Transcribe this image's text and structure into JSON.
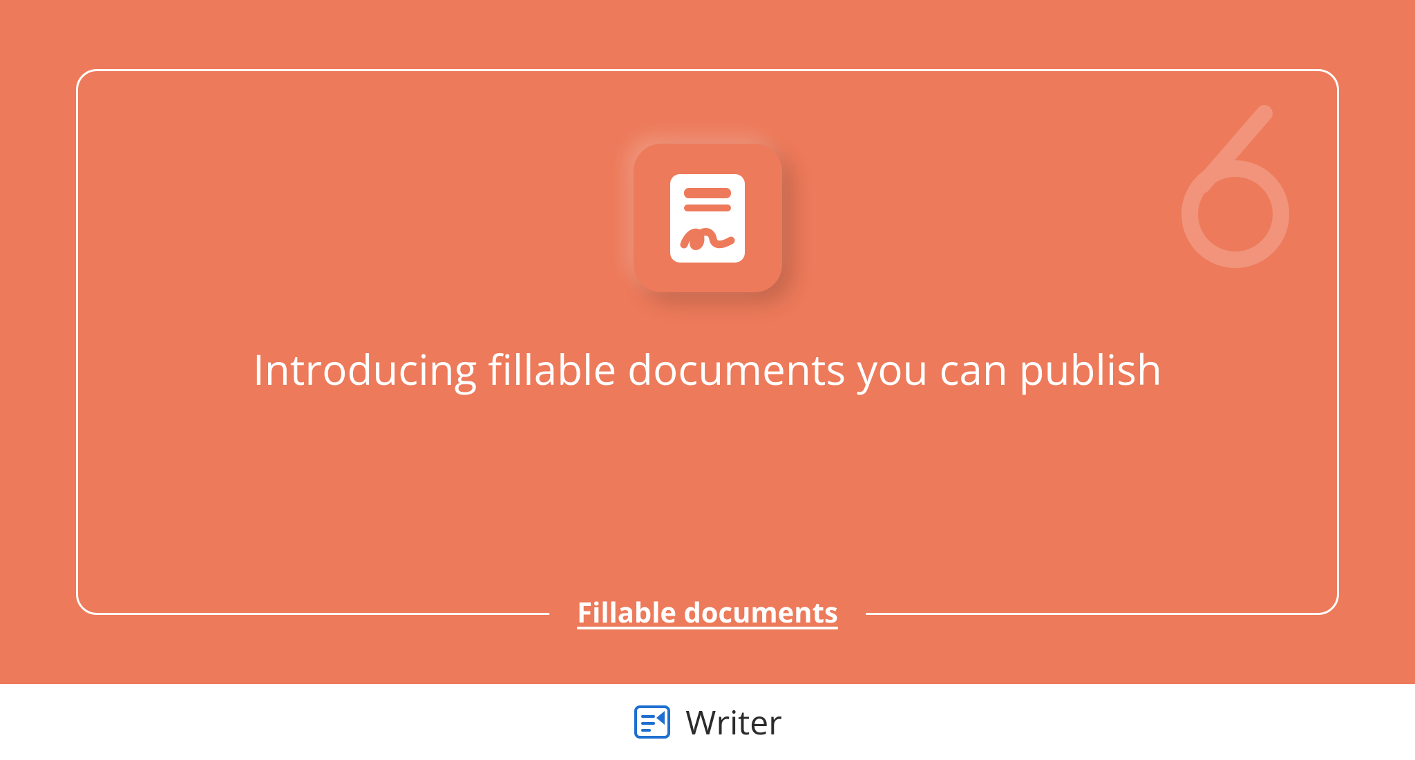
{
  "hero": {
    "headline": "Introducing fillable documents you can publish",
    "subtitle": "Fillable documents",
    "decorative_numeral": "6",
    "icon_name": "fillable-document-icon"
  },
  "footer": {
    "product_name": "Writer",
    "icon_name": "writer-logo-icon"
  },
  "colors": {
    "hero_bg": "#ed7a5a",
    "text_white": "#ffffff",
    "footer_bg": "#ffffff",
    "footer_text": "#2b2b2b",
    "logo_blue": "#1f6fd0"
  }
}
